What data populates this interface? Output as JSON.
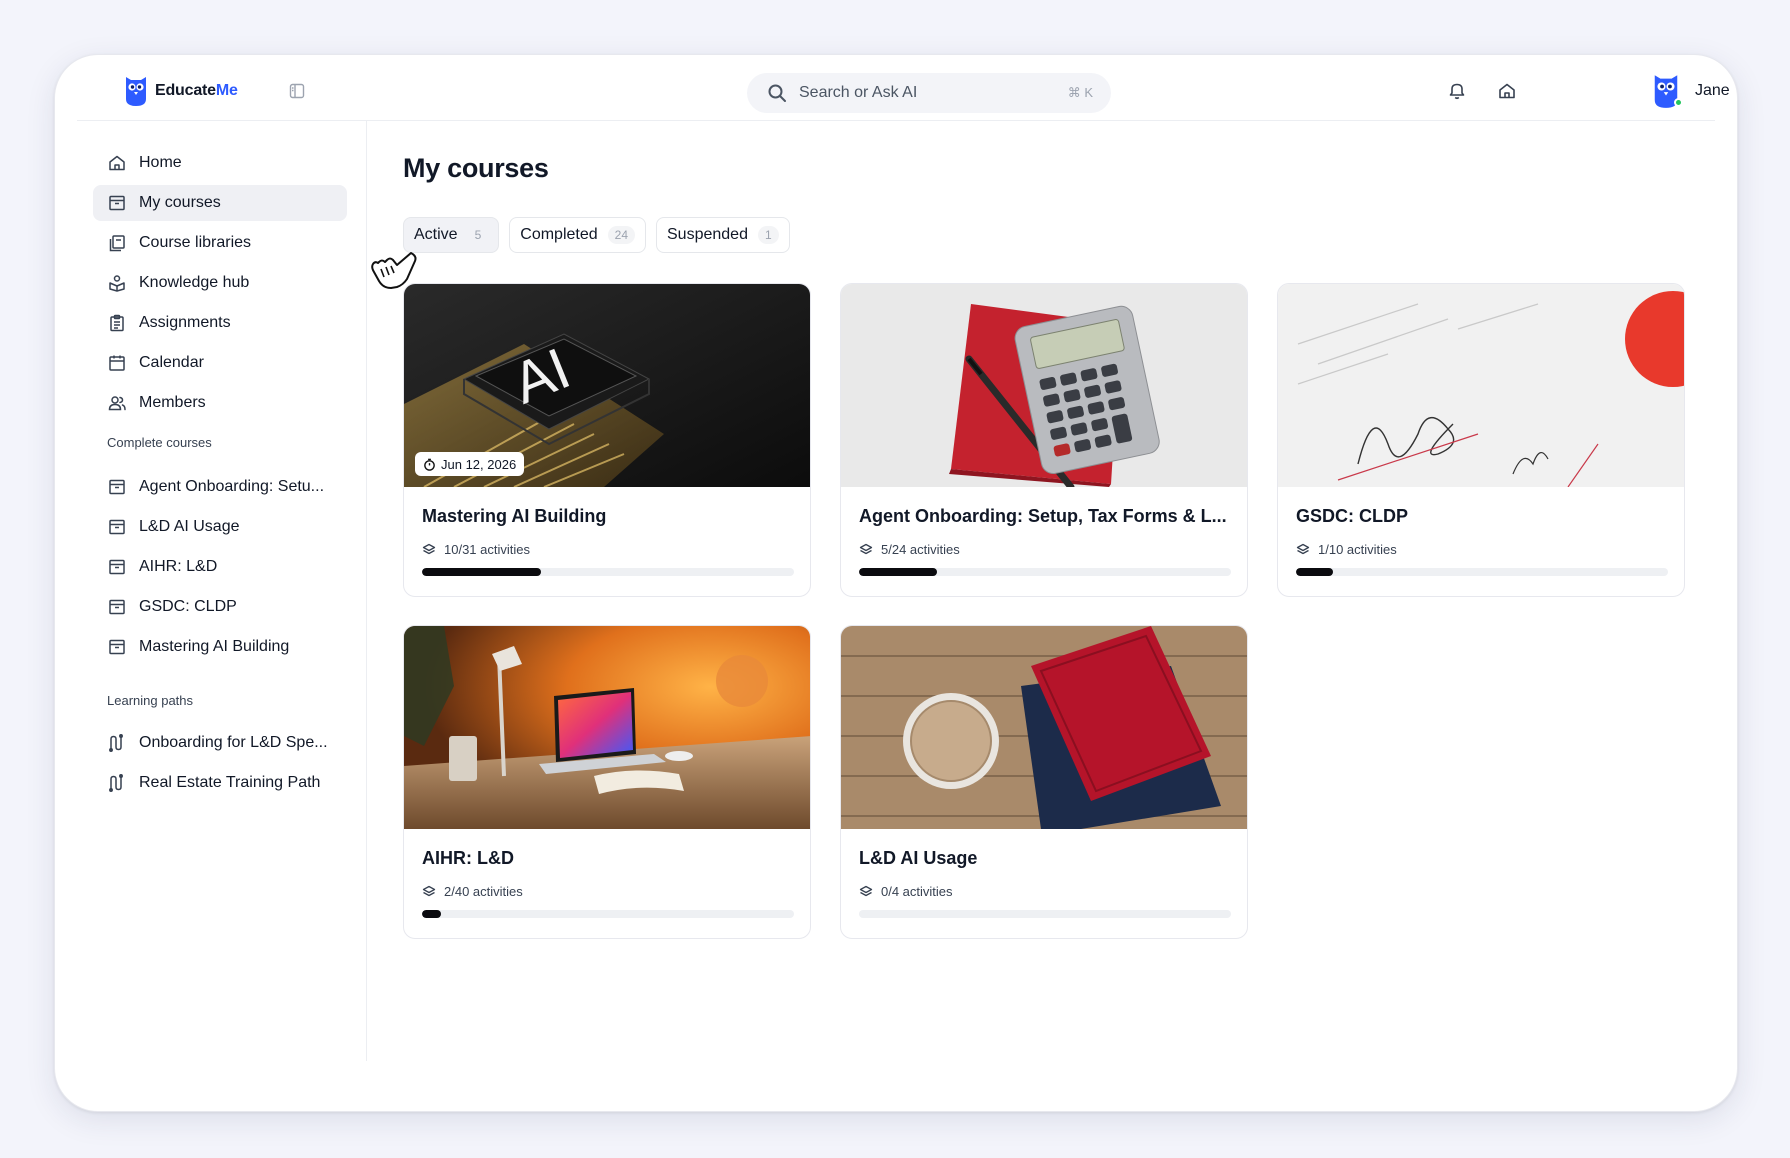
{
  "app": {
    "logo_prefix": "Educate",
    "logo_suffix": "Me"
  },
  "search": {
    "placeholder": "Search or Ask AI",
    "shortcut": "⌘ K"
  },
  "user": {
    "name": "Jane"
  },
  "sidebar": {
    "nav": [
      {
        "label": "Home",
        "icon": "home-icon"
      },
      {
        "label": "My courses",
        "icon": "archive-box-icon",
        "active": true
      },
      {
        "label": "Course libraries",
        "icon": "library-icon"
      },
      {
        "label": "Knowledge hub",
        "icon": "knowledge-hub-icon"
      },
      {
        "label": "Assignments",
        "icon": "clipboard-icon"
      },
      {
        "label": "Calendar",
        "icon": "calendar-icon"
      },
      {
        "label": "Members",
        "icon": "users-icon"
      }
    ],
    "complete_courses_title": "Complete courses",
    "complete_courses": [
      {
        "label": "Agent Onboarding: Setu..."
      },
      {
        "label": "L&D AI Usage"
      },
      {
        "label": "AIHR: L&D"
      },
      {
        "label": "GSDC: CLDP"
      },
      {
        "label": "Mastering AI Building"
      }
    ],
    "learning_paths_title": "Learning paths",
    "learning_paths": [
      {
        "label": "Onboarding for L&D Spe..."
      },
      {
        "label": "Real Estate Training Path"
      }
    ]
  },
  "main": {
    "title": "My courses",
    "tabs": [
      {
        "label": "Active",
        "count": "5",
        "active": true
      },
      {
        "label": "Completed",
        "count": "24"
      },
      {
        "label": "Suspended",
        "count": "1"
      }
    ],
    "courses": [
      {
        "title": "Mastering AI Building",
        "activities": "10/31 activities",
        "progress": 0.32,
        "date": "Jun 12, 2026"
      },
      {
        "title": "Agent Onboarding: Setup, Tax Forms & L...",
        "activities": "5/24 activities",
        "progress": 0.21
      },
      {
        "title": "GSDC: CLDP",
        "activities": "1/10 activities",
        "progress": 0.1
      },
      {
        "title": "AIHR: L&D",
        "activities": "2/40 activities",
        "progress": 0.05
      },
      {
        "title": "L&D AI Usage",
        "activities": "0/4 activities",
        "progress": 0
      }
    ]
  },
  "colors": {
    "brand": "#2e5bff",
    "progress_fill": "#0b0b0f",
    "progress_track": "#eef0f3",
    "active_nav_bg": "#eff0f4",
    "online": "#22c55e"
  }
}
